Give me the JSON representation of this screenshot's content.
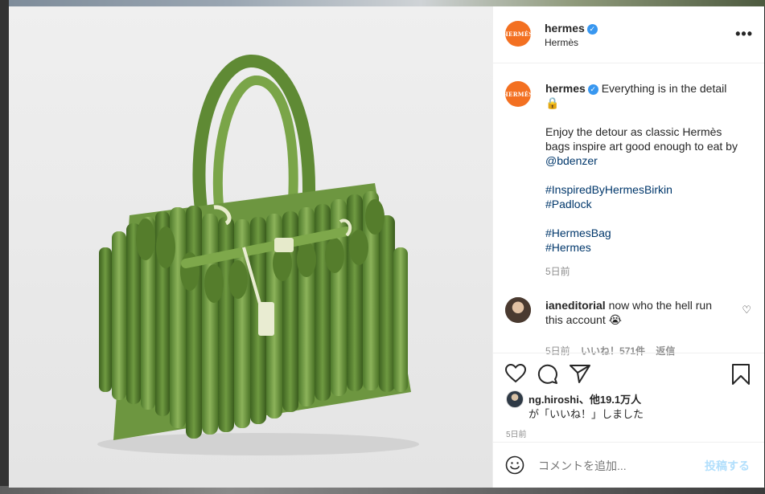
{
  "header": {
    "username": "hermes",
    "display_name": "Hermès",
    "avatar_text": "HERMÈS",
    "more_label": "•••"
  },
  "caption": {
    "username": "hermes",
    "line1": "Everything is in the detail",
    "emoji": "🔒",
    "paragraph": "Enjoy the detour as classic Hermès bags inspire art good enough to eat by",
    "mention": "@bdenzer",
    "tags1": [
      "#InspiredByHermesBirkin",
      "#Padlock"
    ],
    "tags2": [
      "#HermesBag",
      "#Hermes"
    ],
    "time": "5日前"
  },
  "comment": {
    "username": "ianeditorial",
    "text": "now who the hell run this account",
    "emoji": "😭",
    "time": "5日前",
    "likes": "いいね！571件",
    "reply": "返信"
  },
  "likes": {
    "user": "ng.hiroshi",
    "others": "、他19.1万人",
    "suffix": "が「いいね！」しました",
    "time": "5日前"
  },
  "add_comment": {
    "placeholder": "コメントを追加...",
    "post_label": "投稿する"
  },
  "icons": {
    "like": "heart-icon",
    "comment": "comment-icon",
    "share": "send-icon",
    "save": "bookmark-icon",
    "emoji": "smiley-icon",
    "more": "more-icon",
    "verified": "verified-badge-icon"
  },
  "colors": {
    "brand": "#f37021",
    "link": "#00376b",
    "verified": "#3897f0",
    "post_disabled": "#b2dffc"
  }
}
